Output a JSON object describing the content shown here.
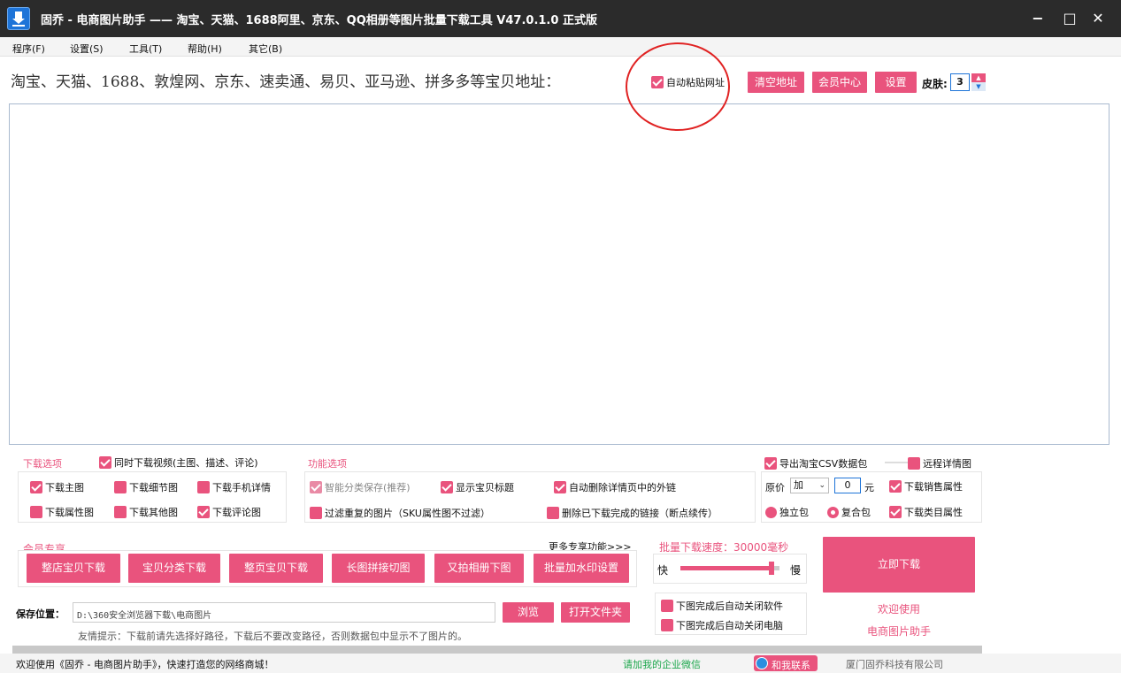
{
  "window": {
    "title": "固乔 - 电商图片助手 —— 淘宝、天猫、1688阿里、京东、QQ相册等图片批量下载工具 V47.0.1.0 正式版",
    "min": "−",
    "max": "□",
    "close": "✕"
  },
  "menu": [
    "程序(F)",
    "设置(S)",
    "工具(T)",
    "帮助(H)",
    "其它(B)"
  ],
  "toolbar": {
    "url_label": "淘宝、天猫、1688、敦煌网、京东、速卖通、易贝、亚马逊、拼多多等宝贝地址：",
    "auto_paste": "自动粘贴网址",
    "clear": "清空地址",
    "member": "会员中心",
    "settings": "设置",
    "skin_label": "皮肤:",
    "skin_value": "3"
  },
  "url_input": {
    "value": ""
  },
  "download_options": {
    "title": "下载选项",
    "video": "同时下载视频(主图、描述、评论)",
    "main": "下载主图",
    "detail": "下载细节图",
    "mobile": "下载手机详情",
    "attr": "下载属性图",
    "other": "下载其他图",
    "comment": "下载评论图"
  },
  "func_options": {
    "title": "功能选项",
    "smart": "智能分类保存(推荐)",
    "show_title": "显示宝贝标题",
    "auto_del": "自动删除详情页中的外链",
    "filter": "过滤重复的图片（SKU属性图不过滤）",
    "delete_done": "删除已下载完成的链接（断点续传）"
  },
  "right_options": {
    "csv": "导出淘宝CSV数据包",
    "remote": "远程详情图",
    "price_label": "原价",
    "price_op": "加",
    "price_value": "0",
    "price_unit": "元",
    "sales": "下载销售属性",
    "single": "独立包",
    "compound": "复合包",
    "category": "下载类目属性"
  },
  "member": {
    "title": "会员专享",
    "more": "更多专享功能>>>",
    "buttons": [
      "整店宝贝下载",
      "宝贝分类下载",
      "整页宝贝下载",
      "长图拼接切图",
      "又拍相册下图",
      "批量加水印设置"
    ]
  },
  "speed": {
    "label": "批量下载速度：30000毫秒",
    "fast": "快",
    "slow": "慢",
    "level": 0.95
  },
  "download_now": "立即下载",
  "after": {
    "close_app": "下图完成后自动关闭软件",
    "close_pc": "下图完成后自动关闭电脑"
  },
  "welcome": {
    "line1": "欢迎使用",
    "line2": "电商图片助手"
  },
  "save": {
    "label": "保存位置：",
    "path": "D:\\360安全浏览器下载\\电商图片",
    "browse": "浏览",
    "open_folder": "打开文件夹",
    "tip": "友情提示：下载前请先选择好路径，下载后不要改变路径，否则数据包中显示不了图片的。"
  },
  "status": {
    "left": "欢迎使用《固乔 - 电商图片助手》，快速打造您的网络商城！",
    "wechat": "请加我的企业微信",
    "contact": "和我联系",
    "company": "厦门固乔科技有限公司"
  },
  "colors": {
    "accent": "#e9537d",
    "titlebar": "#2b2b2b",
    "highlight_circle": "#e02222"
  }
}
